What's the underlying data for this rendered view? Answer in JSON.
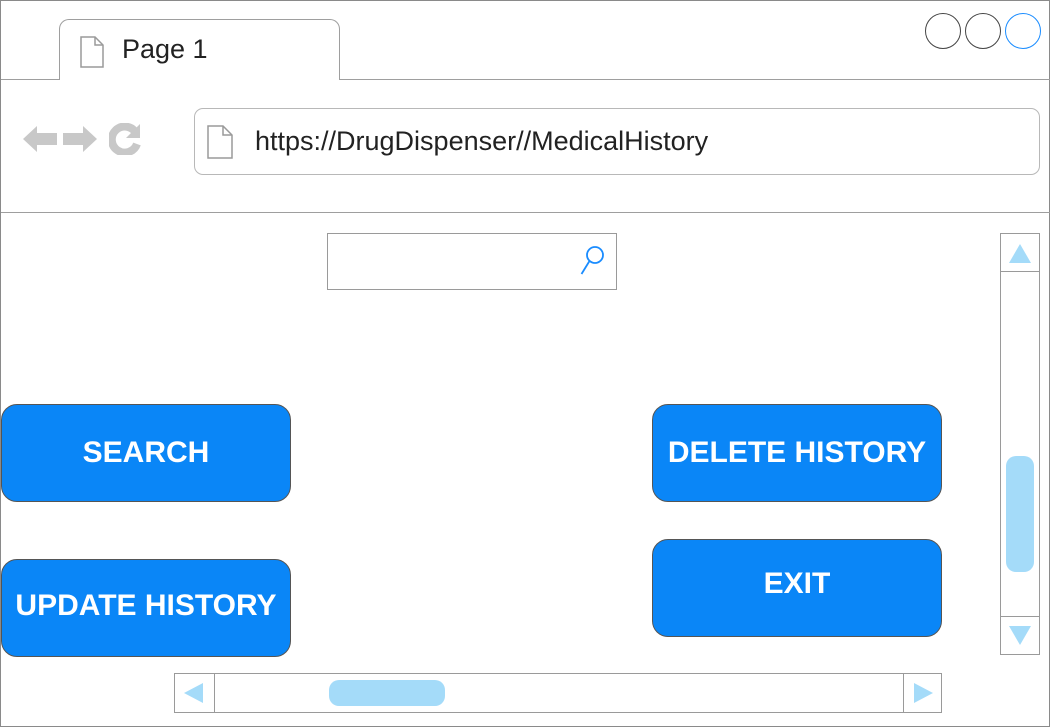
{
  "window": {
    "controls": [
      "minimize",
      "maximize",
      "close"
    ]
  },
  "tab": {
    "label": "Page 1",
    "icon": "page-icon"
  },
  "navigation": {
    "back_icon": "back-arrow-icon",
    "forward_icon": "forward-arrow-icon",
    "reload_icon": "reload-icon",
    "url": "https://DrugDispenser//MedicalHistory",
    "url_icon": "page-icon"
  },
  "search": {
    "value": "",
    "placeholder": "",
    "icon": "search-icon"
  },
  "buttons": {
    "search": "SEARCH",
    "delete_history": "DELETE HISTORY",
    "update_history": "UPDATE HISTORY",
    "exit": "EXIT"
  },
  "colors": {
    "button_bg": "#0a86f7",
    "button_text": "#ffffff",
    "scroll_accent": "#a4dbf9",
    "active_control": "#1a8cff"
  }
}
